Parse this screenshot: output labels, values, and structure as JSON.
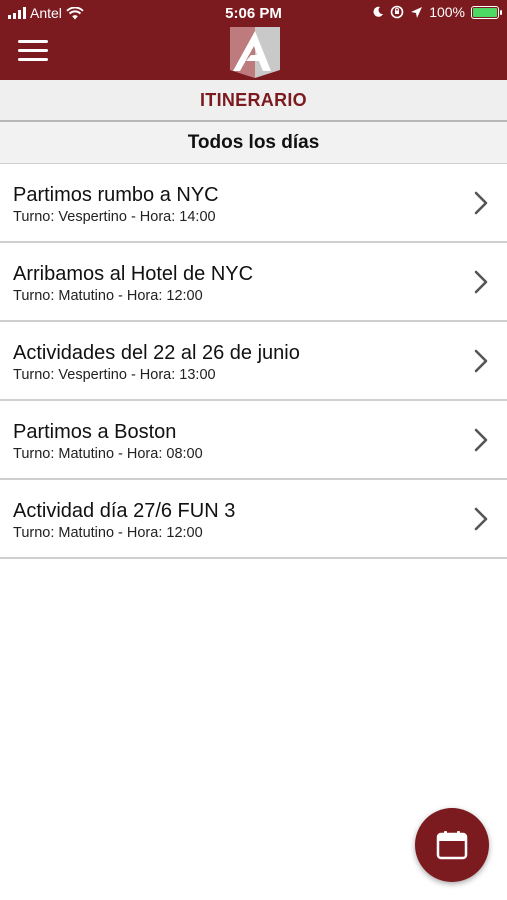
{
  "status_bar": {
    "carrier": "Antel",
    "time": "5:06 PM",
    "battery_label": "100%",
    "battery_level": 1.0
  },
  "header": {
    "menu_icon": "hamburger-menu-icon",
    "logo_icon": "app-logo-icon"
  },
  "section_title": "ITINERARIO",
  "filter_label": "Todos los días",
  "items": [
    {
      "title": "Partimos rumbo a NYC",
      "subtitle": "Turno: Vespertino - Hora: 14:00"
    },
    {
      "title": "Arribamos al Hotel de NYC",
      "subtitle": "Turno: Matutino - Hora: 12:00"
    },
    {
      "title": "Actividades del 22 al 26 de junio",
      "subtitle": "Turno: Vespertino - Hora: 13:00"
    },
    {
      "title": "Partimos a Boston",
      "subtitle": "Turno: Matutino - Hora: 08:00"
    },
    {
      "title": "Actividad día 27/6 FUN 3",
      "subtitle": "Turno: Matutino - Hora: 12:00"
    }
  ],
  "fab_icon": "calendar-icon",
  "colors": {
    "brand": "#7b1a1f",
    "header_bg": "#efefef",
    "divider": "#cfcfcf",
    "battery": "#4cd964"
  }
}
